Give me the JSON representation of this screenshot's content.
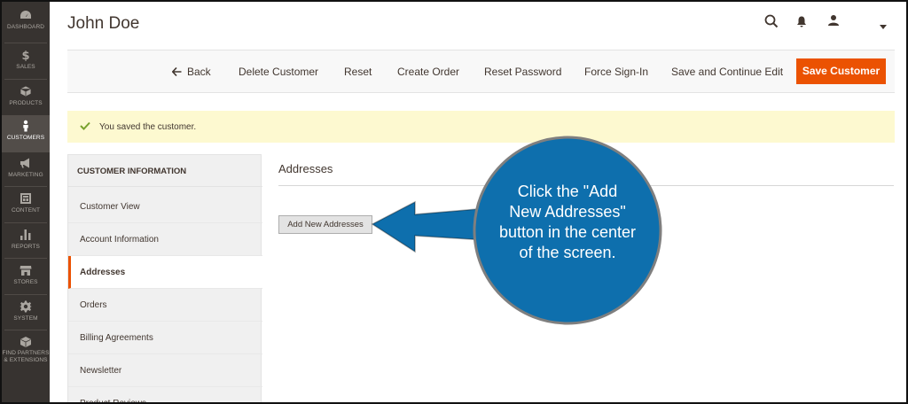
{
  "sidebar": {
    "items": [
      {
        "label": "DASHBOARD",
        "icon": "dashboard-icon"
      },
      {
        "label": "SALES",
        "icon": "dollar-icon"
      },
      {
        "label": "PRODUCTS",
        "icon": "cube-icon"
      },
      {
        "label": "CUSTOMERS",
        "icon": "person-icon"
      },
      {
        "label": "MARKETING",
        "icon": "megaphone-icon"
      },
      {
        "label": "CONTENT",
        "icon": "layout-icon"
      },
      {
        "label": "REPORTS",
        "icon": "bar-chart-icon"
      },
      {
        "label": "STORES",
        "icon": "store-icon"
      },
      {
        "label": "SYSTEM",
        "icon": "gear-icon"
      },
      {
        "label_line1": "FIND PARTNERS",
        "label_line2": "& EXTENSIONS",
        "icon": "box-icon"
      }
    ],
    "active": "CUSTOMERS",
    "bg_color": "#373330"
  },
  "header": {
    "title": "John Doe",
    "icons": [
      "search-icon",
      "bell-icon",
      "user-icon",
      "caret-down-icon"
    ]
  },
  "actions": {
    "back": "Back",
    "delete": "Delete Customer",
    "reset": "Reset",
    "create_order": "Create Order",
    "reset_password": "Reset Password",
    "force_sign_in": "Force Sign-In",
    "save_continue": "Save and Continue Edit",
    "save": "Save Customer",
    "accent_color": "#eb5202"
  },
  "message": {
    "text": "You saved the customer.",
    "bg_color": "#fdf9d0"
  },
  "tabs": {
    "title": "CUSTOMER INFORMATION",
    "items": [
      "Customer View",
      "Account Information",
      "Addresses",
      "Orders",
      "Billing Agreements",
      "Newsletter",
      "Product Reviews"
    ],
    "active": "Addresses"
  },
  "main": {
    "section_title": "Addresses",
    "add_button": "Add New Addresses"
  },
  "callout": {
    "line1": "Click the \"Add",
    "line2": "New Addresses\"",
    "line3": "button in the center",
    "line4": "of the screen.",
    "color": "#0e6fad"
  }
}
